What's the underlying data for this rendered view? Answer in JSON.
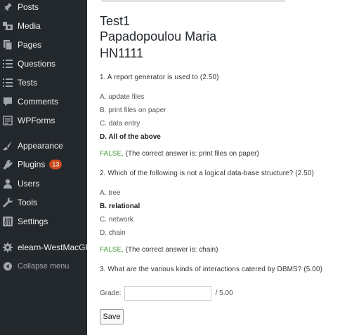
{
  "sidebar": {
    "items": [
      {
        "label": "Posts",
        "icon": "pin-icon"
      },
      {
        "label": "Media",
        "icon": "media-icon"
      },
      {
        "label": "Pages",
        "icon": "pages-icon"
      },
      {
        "label": "Questions",
        "icon": "list-icon"
      },
      {
        "label": "Tests",
        "icon": "tests-icon"
      },
      {
        "label": "Comments",
        "icon": "comment-icon"
      },
      {
        "label": "WPForms",
        "icon": "forms-icon"
      },
      {
        "label": "Appearance",
        "icon": "brush-icon"
      },
      {
        "label": "Plugins",
        "icon": "plugin-icon",
        "badge": "13"
      },
      {
        "label": "Users",
        "icon": "user-icon"
      },
      {
        "label": "Tools",
        "icon": "wrench-icon"
      },
      {
        "label": "Settings",
        "icon": "settings-icon"
      },
      {
        "label": "elearn-WestMacGR",
        "icon": "gear-icon"
      },
      {
        "label": "Collapse menu",
        "icon": "collapse-icon"
      }
    ]
  },
  "header": {
    "test_name": "Test1",
    "student_name": "Papadopoulou Maria",
    "student_id": "HN1111"
  },
  "questions": [
    {
      "text": "1. A report generator is used to (2.50)",
      "options": [
        "A. update files",
        "B. print files on paper",
        "C. data entry",
        "D. All of the above"
      ],
      "selected_index": 3,
      "verdict_label": "FALSE,",
      "verdict_detail": " (The correct answer is: print files on paper)"
    },
    {
      "text": "2. Which of the following is not a logical data-base structure? (2.50)",
      "options": [
        "A. tree",
        "B. relational",
        "C. network",
        "D. chain"
      ],
      "selected_index": 1,
      "verdict_label": "FALSE,",
      "verdict_detail": " (The correct answer is: chain)"
    },
    {
      "text": "3. What are the various kinds of interactions catered by DBMS? (5.00)"
    }
  ],
  "grading": {
    "grade_label": "Grade:",
    "grade_value": "",
    "max_label": "/ 5.00",
    "save_label": "Save"
  },
  "colors": {
    "sidebar_bg": "#23282d",
    "false_color": "#46a03a",
    "badge": "#ca4a1f"
  }
}
